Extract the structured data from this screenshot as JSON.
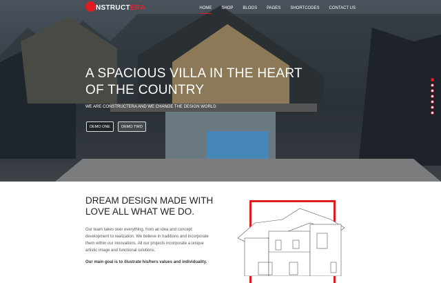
{
  "brand": {
    "logo_prefix": "C",
    "logo_main": "NSTRUCT",
    "logo_accent": "ERA"
  },
  "nav": {
    "items": [
      "HOME",
      "SHOP",
      "BLOGS",
      "PAGES",
      "SHORTCODES",
      "CONTACT US"
    ],
    "active": "HOME"
  },
  "hero": {
    "title": "A SPACIOUS VILLA IN THE HEART OF THE COUNTRY",
    "subtitle": "WE ARE CONSTRUCTERA AND WE CHANGE THE DESIGN WORLD",
    "buttons": [
      "DEMO ONE",
      "DEMO TWO"
    ],
    "slides": 7,
    "active_slide": 1
  },
  "about": {
    "heading": "DREAM DESIGN MADE WITH LOVE ALL WHAT WE DO.",
    "paragraph": "Our team takes over everything, from an idea and concept development to realization. We believe in traditions and incorporate them within our innovations. All our projects incorporate a unique artistic image and functional solutions.",
    "goal": "Our main goal is to illustrate his/hers values and individuality."
  },
  "colors": {
    "accent": "#e01b22"
  }
}
